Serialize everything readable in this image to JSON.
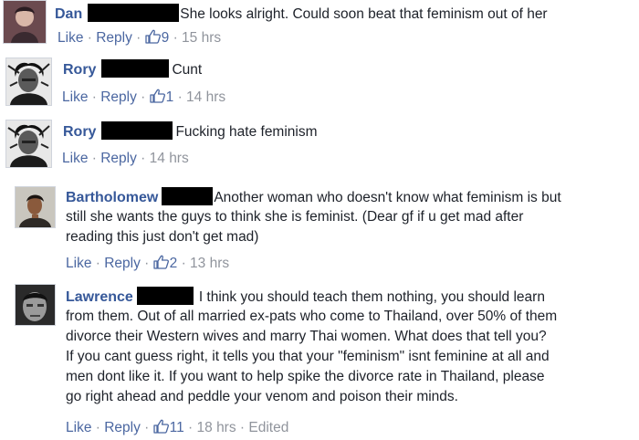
{
  "comments": [
    {
      "author": "Dan",
      "text": "She looks alright. Could soon beat that feminism out of her",
      "actions": {
        "like": "Like",
        "reply": "Reply",
        "likes": "9",
        "time": "15 hrs",
        "edited": ""
      }
    },
    {
      "author": "Rory",
      "text": "Cunt",
      "actions": {
        "like": "Like",
        "reply": "Reply",
        "likes": "1",
        "time": "14 hrs",
        "edited": ""
      }
    },
    {
      "author": "Rory",
      "text": "Fucking hate feminism",
      "actions": {
        "like": "Like",
        "reply": "Reply",
        "likes": "",
        "time": "14 hrs",
        "edited": ""
      }
    },
    {
      "author": "Bartholomew",
      "text_lines": [
        "Another woman who doesn't know what feminism is but",
        "still she wants the guys to think she is feminist. (Dear gf if u get mad after",
        "reading this just don't get mad)"
      ],
      "actions": {
        "like": "Like",
        "reply": "Reply",
        "likes": "2",
        "time": "13 hrs",
        "edited": ""
      }
    },
    {
      "author": "Lawrence",
      "text_lines": [
        "I think you should teach them nothing, you should learn",
        "from them. Out of all married ex-pats who come to Thailand, over 50% of them",
        "divorce their Western wives and marry Thai women. What does that tell you?",
        "If you cant guess right, it tells you that your \"feminism\" isnt feminine at all and",
        "men dont like it. If you want to help spike the divorce rate in Thailand, please",
        "go right ahead and peddle your venom and poison their minds."
      ],
      "actions": {
        "like": "Like",
        "reply": "Reply",
        "likes": "11",
        "time": "18 hrs",
        "edited": "Edited"
      }
    }
  ],
  "separator": " · ",
  "icons": {
    "like": "thumbs-up-icon",
    "avatar": "profile-photo"
  },
  "colors": {
    "name": "#365899",
    "link": "#4b67a1",
    "meta": "#90949c",
    "redaction": "#000000"
  }
}
